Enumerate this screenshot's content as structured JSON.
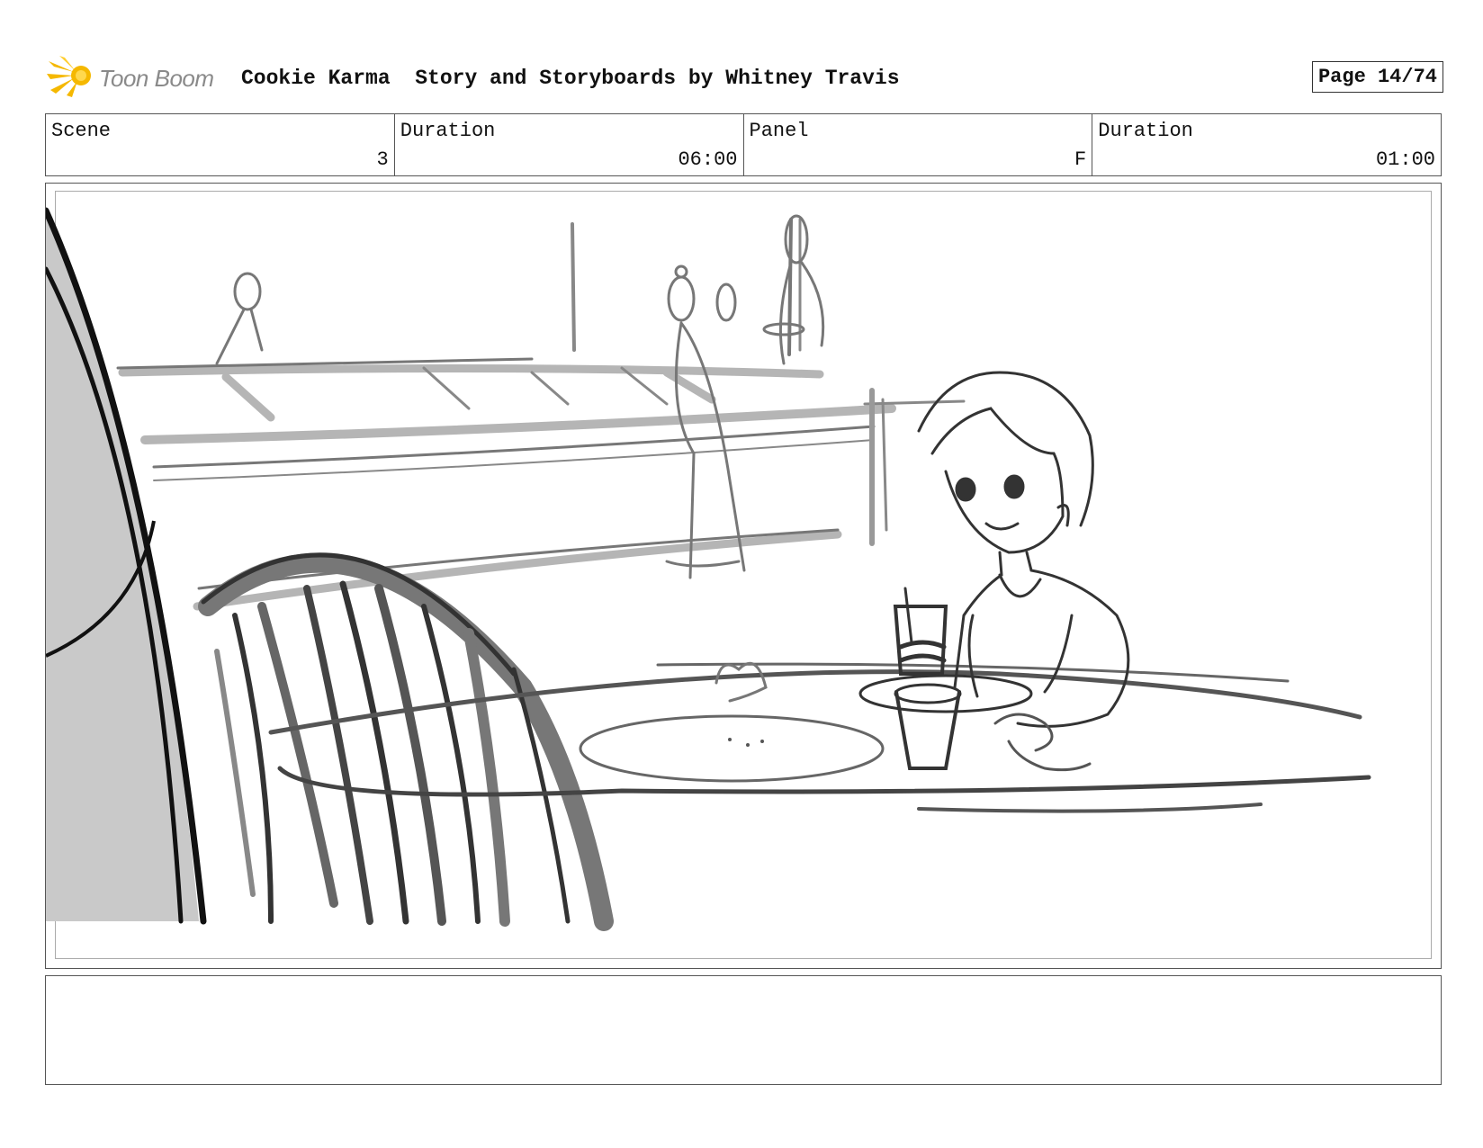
{
  "header": {
    "logo_text": "Toon Boom",
    "title": "Cookie Karma  Story and Storyboards by Whitney Travis",
    "page": "Page 14/74"
  },
  "info": {
    "scene_label": "Scene",
    "scene_value": "3",
    "scene_duration_label": "Duration",
    "scene_duration_value": "06:00",
    "panel_label": "Panel",
    "panel_value": "F",
    "panel_duration_label": "Duration",
    "panel_duration_value": "01:00"
  },
  "notes": {
    "text": ""
  },
  "colors": {
    "logo_accent": "#f5b800",
    "sketch_dark": "#111111",
    "sketch_mid": "#6a6a6a",
    "sketch_light": "#b5b5b5",
    "fill_gray": "#c9c9c9"
  }
}
